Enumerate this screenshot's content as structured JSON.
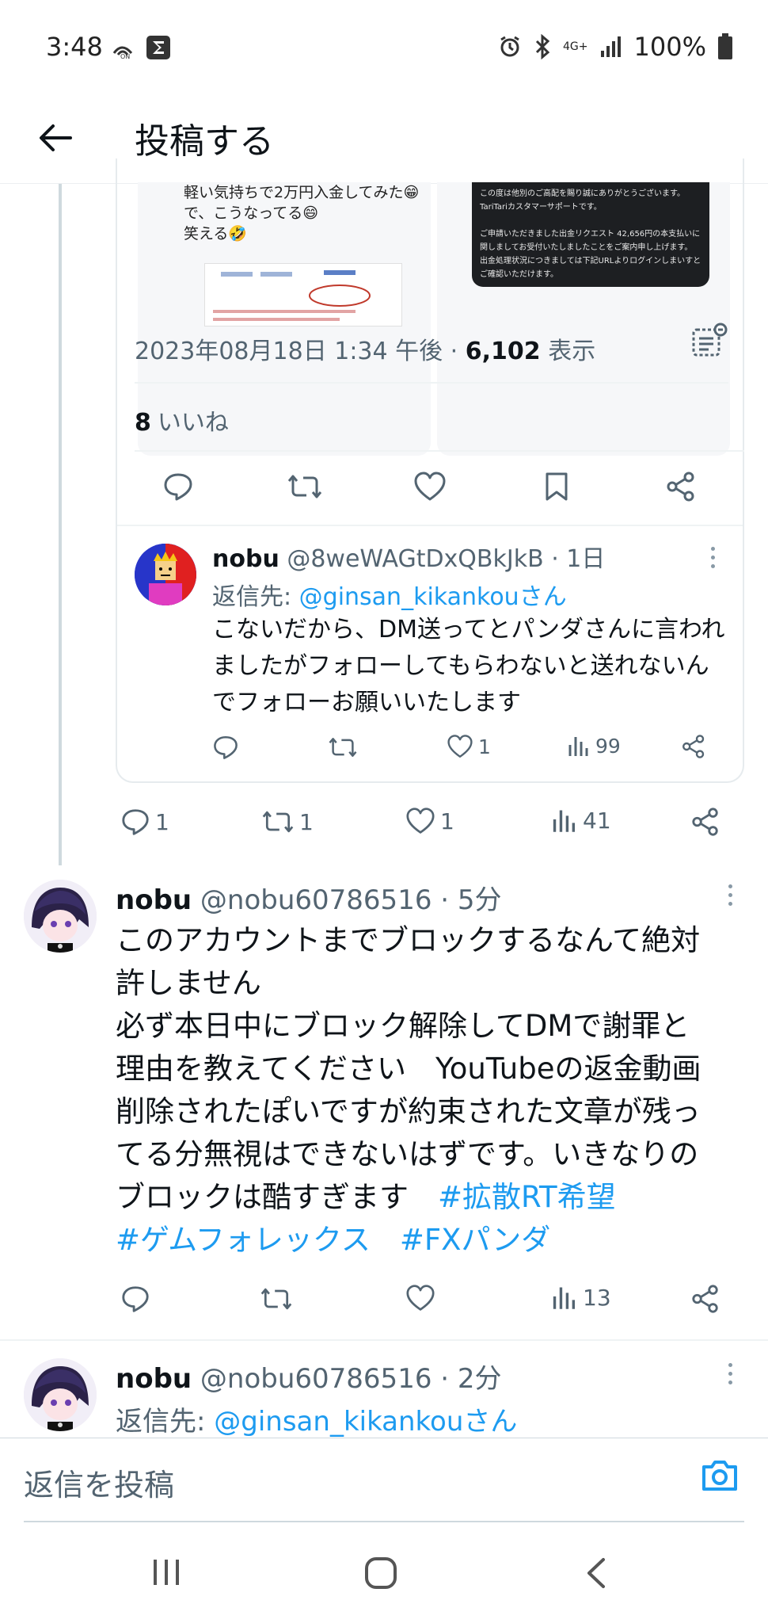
{
  "status_bar": {
    "time": "3:48",
    "network": "4G+",
    "battery": "100%"
  },
  "header": {
    "title": "投稿する"
  },
  "quoted_images": {
    "left_text": "軽い気持ちで2万円入金してみた😁\nで、こうなってる😄\n笑える🤣",
    "right_text": "この度は他別のご高配を賜り誠にありがとうございます。\nTariTariカスタマーサポートです。\n\nご申請いただきました出金リクエスト 42,656円の本支払いに関しましてお受付いたしましたことをご案内申し上げます。\n出金処理状況につきましては下記URLよりログインしまいすとご確認いただけます。"
  },
  "tweet_detail": {
    "datetime": "2023年08月18日 1:34 午後 · ",
    "views_count": "6,102",
    "views_label": " 表示",
    "likes_count": "8",
    "likes_label": "いいね"
  },
  "nested_reply": {
    "name": "nobu",
    "handle": " @8weWAGtDxQBkJkB · 1日",
    "reply_to_prefix": "返信先: ",
    "reply_to_user": "@ginsan_kikankouさん",
    "text": "こないだから、DM送ってとパンダさんに言われましたがフォローしてもらわないと送れないんでフォローお願いいたします",
    "likes": "1",
    "views": "99"
  },
  "parent_actions": {
    "replies": "1",
    "retweets": "1",
    "likes": "1",
    "views": "41"
  },
  "tweet_1": {
    "name": "nobu",
    "handle": " @nobu60786516 · 5分",
    "text_lines": [
      "このアカウントまでブロックするなんて絶対",
      "許しません",
      "必ず本日中にブロック解除してDMで謝罪と",
      "理由を教えてください　YouTubeの返金動画",
      "削除されたぽいですが約束された文章が残っ",
      "てる分無視はできないはずです。いきなりの",
      "ブロックは酷すぎます　"
    ],
    "tag_1": "#拡散RT希望",
    "tag_2": "#ゲムフォレックス",
    "tag_3": "#FXパンダ",
    "views": "13"
  },
  "tweet_2": {
    "name": "nobu",
    "handle": " @nobu60786516 · 2分",
    "reply_to_prefix": "返信先: ",
    "reply_to_user": "@ginsan_kikankouさん"
  },
  "compose": {
    "placeholder": "返信を投稿"
  },
  "colors": {
    "accent": "#1d9bf0",
    "text": "#0f1419",
    "muted": "#536471"
  }
}
